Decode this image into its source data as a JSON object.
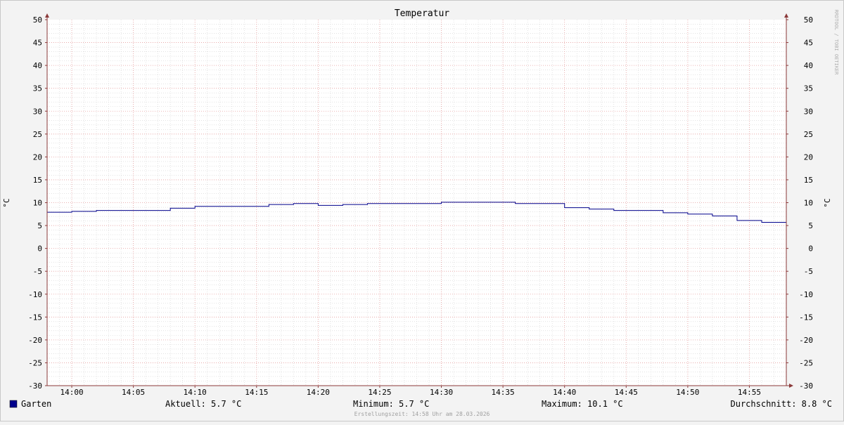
{
  "chart_data": {
    "type": "line",
    "title": "Temperatur",
    "ylabel": "°C",
    "ylabel_right": "°C",
    "ylim": [
      -30,
      50
    ],
    "y_ticks": [
      -30,
      -25,
      -20,
      -15,
      -10,
      -5,
      0,
      5,
      10,
      15,
      20,
      25,
      30,
      35,
      40,
      45,
      50
    ],
    "x_range": [
      "13:58",
      "14:58"
    ],
    "x_ticks": [
      "14:00",
      "14:05",
      "14:10",
      "14:15",
      "14:20",
      "14:25",
      "14:30",
      "14:35",
      "14:40",
      "14:45",
      "14:50",
      "14:55"
    ],
    "grid": true,
    "series": [
      {
        "name": "Garten",
        "color": "#00008b",
        "step": true,
        "points": [
          [
            "13:58",
            7.9
          ],
          [
            "14:00",
            8.1
          ],
          [
            "14:02",
            8.3
          ],
          [
            "14:04",
            8.3
          ],
          [
            "14:06",
            8.3
          ],
          [
            "14:08",
            8.8
          ],
          [
            "14:10",
            9.2
          ],
          [
            "14:12",
            9.2
          ],
          [
            "14:14",
            9.2
          ],
          [
            "14:16",
            9.6
          ],
          [
            "14:18",
            9.8
          ],
          [
            "14:20",
            9.4
          ],
          [
            "14:22",
            9.6
          ],
          [
            "14:24",
            9.8
          ],
          [
            "14:26",
            9.8
          ],
          [
            "14:28",
            9.8
          ],
          [
            "14:30",
            10.1
          ],
          [
            "14:32",
            10.1
          ],
          [
            "14:34",
            10.1
          ],
          [
            "14:36",
            9.8
          ],
          [
            "14:38",
            9.8
          ],
          [
            "14:40",
            8.9
          ],
          [
            "14:42",
            8.6
          ],
          [
            "14:44",
            8.3
          ],
          [
            "14:46",
            8.3
          ],
          [
            "14:48",
            7.8
          ],
          [
            "14:50",
            7.5
          ],
          [
            "14:52",
            7.1
          ],
          [
            "14:54",
            6.1
          ],
          [
            "14:56",
            5.7
          ],
          [
            "14:58",
            5.7
          ]
        ]
      }
    ],
    "legend": {
      "name": "Garten",
      "swatch_color": "#00008b",
      "current": "Aktuell: 5.7 °C",
      "minimum": "Minimum: 5.7 °C",
      "maximum": "Maximum: 10.1 °C",
      "average": "Durchschnitt: 8.8 °C"
    },
    "footer": "Erstellungszeit: 14:58 Uhr am 28.03.2026",
    "watermark": "RRDTOOL / TOBI OETIKER"
  },
  "colors": {
    "background": "#f3f3f3",
    "canvas": "#ffffff",
    "grid_minor": "#d2d2d2",
    "grid_major": "#e8a0a0",
    "axis": "#8b3a3a",
    "text": "#000000",
    "footer_text": "#a0a0a0"
  }
}
